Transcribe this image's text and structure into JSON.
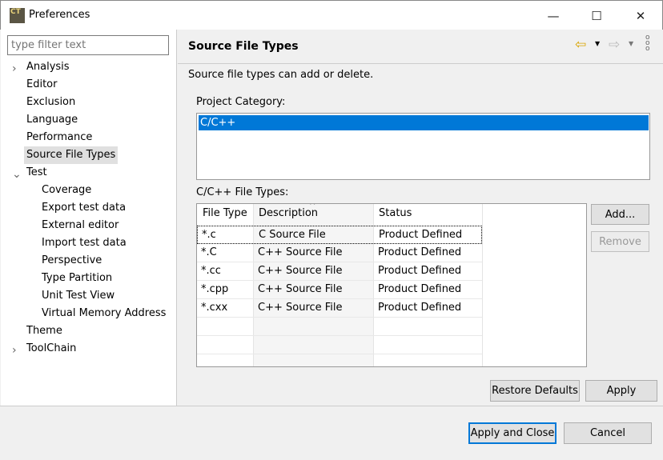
{
  "window": {
    "title": "Preferences",
    "app_icon_text": "CT"
  },
  "filter": {
    "placeholder": "type filter text"
  },
  "tree": [
    {
      "label": "Analysis",
      "level": 0,
      "expander": "›"
    },
    {
      "label": "Editor",
      "level": 0
    },
    {
      "label": "Exclusion",
      "level": 0
    },
    {
      "label": "Language",
      "level": 0
    },
    {
      "label": "Performance",
      "level": 0
    },
    {
      "label": "Source File Types",
      "level": 0,
      "selected": true
    },
    {
      "label": "Test",
      "level": 0,
      "expander": "⌄"
    },
    {
      "label": "Coverage",
      "level": 1
    },
    {
      "label": "Export test data",
      "level": 1
    },
    {
      "label": "External editor",
      "level": 1
    },
    {
      "label": "Import test data",
      "level": 1
    },
    {
      "label": "Perspective",
      "level": 1
    },
    {
      "label": "Type Partition",
      "level": 1
    },
    {
      "label": "Unit Test View",
      "level": 1
    },
    {
      "label": "Virtual Memory Address",
      "level": 1
    },
    {
      "label": "Theme",
      "level": 0
    },
    {
      "label": "ToolChain",
      "level": 0,
      "expander": "›"
    }
  ],
  "page": {
    "title": "Source File Types",
    "description": "Source file types can add or delete.",
    "category_label": "Project Category:",
    "category_selected": "C/C++",
    "file_types_label": "C/C++ File Types:",
    "columns": [
      "File Type",
      "Description",
      "Status"
    ],
    "rows": [
      [
        "*.c",
        "C Source File",
        "Product Defined"
      ],
      [
        "*.C",
        "C++ Source File",
        "Product Defined"
      ],
      [
        "*.cc",
        "C++ Source File",
        "Product Defined"
      ],
      [
        "*.cpp",
        "C++ Source File",
        "Product Defined"
      ],
      [
        "*.cxx",
        "C++ Source File",
        "Product Defined"
      ]
    ],
    "add": "Add...",
    "remove": "Remove",
    "restore": "Restore Defaults",
    "apply": "Apply"
  },
  "footer": {
    "apply_close": "Apply and Close",
    "cancel": "Cancel"
  }
}
